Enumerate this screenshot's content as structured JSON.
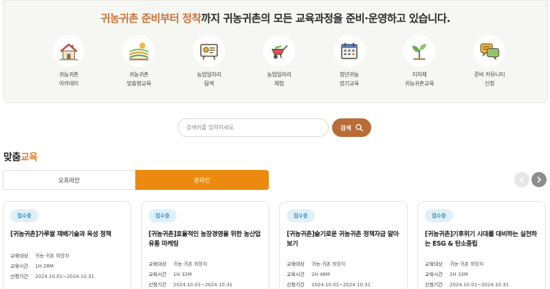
{
  "hero": {
    "title_highlight": "귀농귀촌 준비부터 정착",
    "title_rest": "까지 귀농귀촌의 모든 교육과정을 준비·운영하고 있습니다."
  },
  "categories": [
    {
      "icon": "house-icon",
      "line1": "귀농귀촌",
      "line2": "아카데미"
    },
    {
      "icon": "farm-field-icon",
      "line1": "귀농귀촌",
      "line2": "맞춤형교육"
    },
    {
      "icon": "job-board-icon",
      "line1": "농업일자리",
      "line2": "탐색"
    },
    {
      "icon": "wheelbarrow-icon",
      "line1": "농업일자리",
      "line2": "체험"
    },
    {
      "icon": "calendar-icon",
      "line1": "청년귀농",
      "line2": "장기교육"
    },
    {
      "icon": "sprout-icon",
      "line1": "지자체",
      "line2": "귀농귀촌교육"
    },
    {
      "icon": "chat-bubbles-icon",
      "line1": "준비 커뮤니티",
      "line2": "신청"
    }
  ],
  "search": {
    "placeholder": "검색어를 입력하세요.",
    "button_label": "검색"
  },
  "section": {
    "title_main": "맞춤",
    "title_highlight": "교육"
  },
  "tabs": {
    "offline": "오프라인",
    "online": "온라인",
    "active": "online"
  },
  "colors": {
    "accent_orange": "#ec8a0f",
    "brown": "#b96c36",
    "badge_blue": "#3b8fc0"
  },
  "meta_labels": {
    "target": "교육대상",
    "time": "교육시간",
    "period": "신청기간"
  },
  "cards": [
    {
      "badge": "접수중",
      "title": "[귀농귀촌]가루쌀 재배기술과 육성 정책",
      "target": "귀농·귀촌 희망자",
      "time": "1H 28M",
      "period": "2024.10.01~2024.10.31"
    },
    {
      "badge": "접수중",
      "title": "[귀농귀촌]효율적인 농장경영을 위한 농산업 유통 마케팅",
      "target": "귀농·귀촌 희망자",
      "time": "1H 32M",
      "period": "2024.10.01~2024.10.31"
    },
    {
      "badge": "접수중",
      "title": "[귀농귀촌]슬기로운 귀농귀촌 정책자금 알아보기",
      "target": "귀농·귀촌 희망자",
      "time": "2H 48M",
      "period": "2024.10.01~2024.10.31"
    },
    {
      "badge": "접수중",
      "title": "[귀농귀촌]기후위기 시대를 대비하는 실천하는 ESG & 탄소중립",
      "target": "귀농·귀촌 희망자",
      "time": "2H 33M",
      "period": "2024.10.01~2024.10.31"
    }
  ]
}
